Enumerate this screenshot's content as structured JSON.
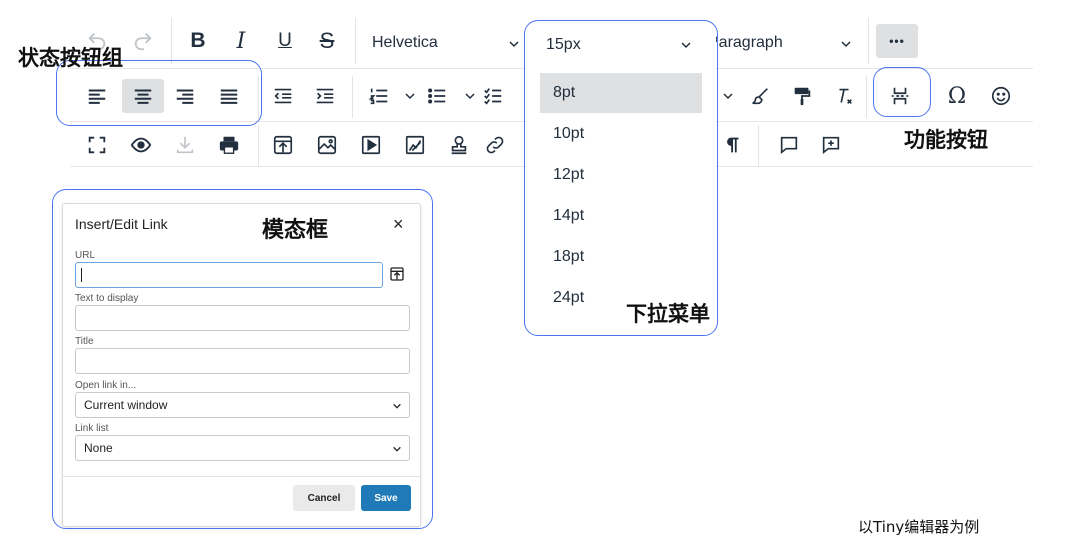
{
  "toolbar_row1": {
    "bold": "B",
    "italic": "I",
    "underline": "U",
    "strike": "S",
    "font_family": "Helvetica",
    "font_size": "15px",
    "block_format": "Paragraph",
    "more": "•••"
  },
  "toolbar_row2": {
    "partial_label": "a",
    "omega": "Ω"
  },
  "dropdown": {
    "options": [
      "8pt",
      "10pt",
      "12pt",
      "14pt",
      "18pt",
      "24pt"
    ],
    "selected": "8pt"
  },
  "modal": {
    "title": "Insert/Edit Link",
    "close": "×",
    "url_label": "URL",
    "text_label": "Text to display",
    "title_label": "Title",
    "open_in_label": "Open link in...",
    "open_in_value": "Current window",
    "link_list_label": "Link list",
    "link_list_value": "None",
    "cancel": "Cancel",
    "save": "Save"
  },
  "annotations": {
    "state_buttons": "状态按钮组",
    "function_buttons": "功能按钮",
    "modal": "模态框",
    "dropdown": "下拉菜单",
    "footer": "以Tiny编辑器为例"
  },
  "colors": {
    "accent_outline": "#4b74f0",
    "save_button": "#207ab7",
    "active_button": "#dee0e2"
  }
}
